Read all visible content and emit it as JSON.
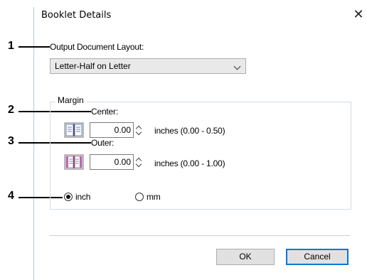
{
  "dialog": {
    "title": "Booklet Details",
    "close_glyph": "✕"
  },
  "layout_section": {
    "label": "Output Document Layout:",
    "selected": "Letter-Half on Letter"
  },
  "margin": {
    "group_title": "Margin",
    "center": {
      "label": "Center:",
      "value": "0.00",
      "range": "inches (0.00 - 0.50)"
    },
    "outer": {
      "label": "Outer:",
      "value": "0.00",
      "range": "inches (0.00 - 1.00)"
    },
    "units": [
      {
        "label": "inch",
        "selected": true
      },
      {
        "label": "mm",
        "selected": false
      }
    ]
  },
  "buttons": {
    "ok": "OK",
    "cancel": "Cancel"
  },
  "callouts": [
    "1",
    "2",
    "3",
    "4"
  ],
  "colors": {
    "accent": "#0078d7",
    "booklet_center": "#6a7bb5",
    "booklet_outer": "#b86bb0"
  }
}
